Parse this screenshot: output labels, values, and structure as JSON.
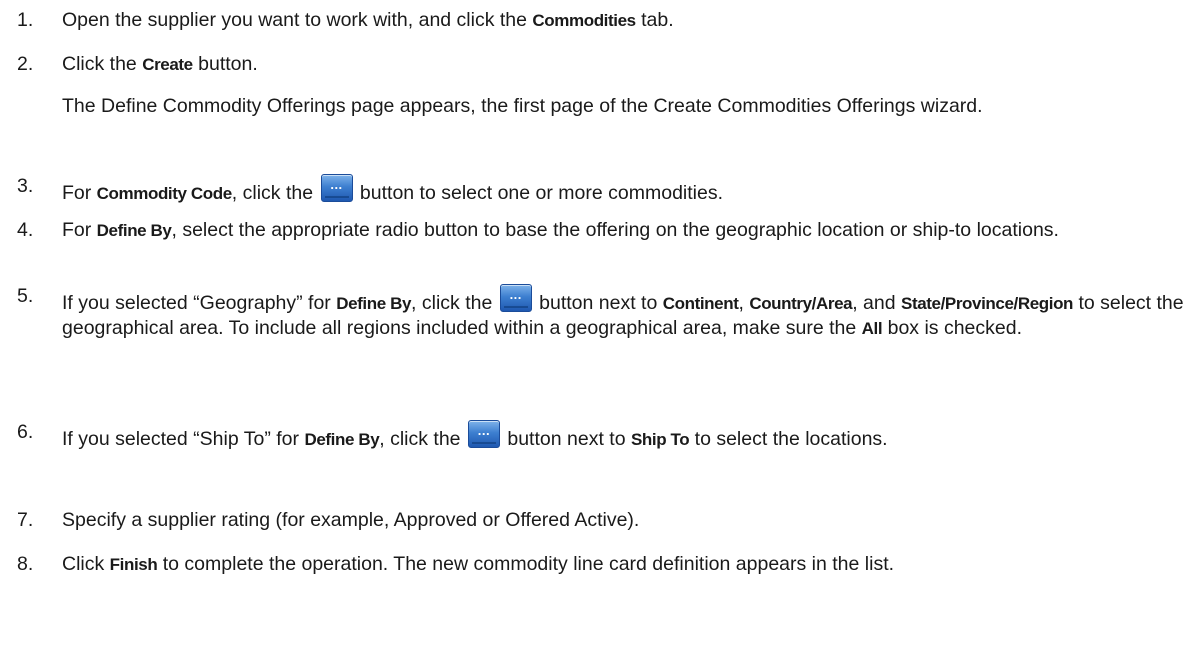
{
  "icons": {
    "ellipsis_button": "ellipsis-button-icon",
    "ellipsis_glyph": "..."
  },
  "colors": {
    "button_blue": "#3d7fd0",
    "text": "#1a1a1a"
  },
  "steps": [
    {
      "number": "1.",
      "t1": "Open the supplier you want to work with, and click the ",
      "b1": "Commodities",
      "t2": " tab."
    },
    {
      "number": "2.",
      "t1": "Click the ",
      "b1": "Create",
      "t2": " button.",
      "note": "The Define Commodity Offerings page appears, the first page of the Create Commodities Offerings wizard."
    },
    {
      "number": "3.",
      "t1": "For ",
      "b1": "Commodity Code",
      "t2": ", click the ",
      "t3": " button to select one or more commodities."
    },
    {
      "number": "4.",
      "t1": "For ",
      "b1": "Define By",
      "t2": ", select the appropriate radio button to base the offering on the geographic location or ship-to locations."
    },
    {
      "number": "5.",
      "t1": "If you selected “Geography” for ",
      "b1": "Define By",
      "t2": ", click the ",
      "t3": " button next to ",
      "b2": "Continent",
      "t4": ", ",
      "b3": "Country/Area",
      "t5": ", and ",
      "b4": "State/Province/Region",
      "t6": " to select the geographical area. To include all regions included within a geographical area, make sure the ",
      "b5": "All",
      "t7": " box is checked."
    },
    {
      "number": "6.",
      "t1": "If you selected “Ship To” for ",
      "b1": "Define By",
      "t2": ", click the ",
      "t3": " button next to ",
      "b2": "Ship To",
      "t4": " to select the locations."
    },
    {
      "number": "7.",
      "t1": "Specify a supplier rating (for example, Approved or Offered Active)."
    },
    {
      "number": "8.",
      "t1": "Click ",
      "b1": "Finish",
      "t2": " to complete the operation. The new commodity line card definition appears in the list."
    }
  ]
}
